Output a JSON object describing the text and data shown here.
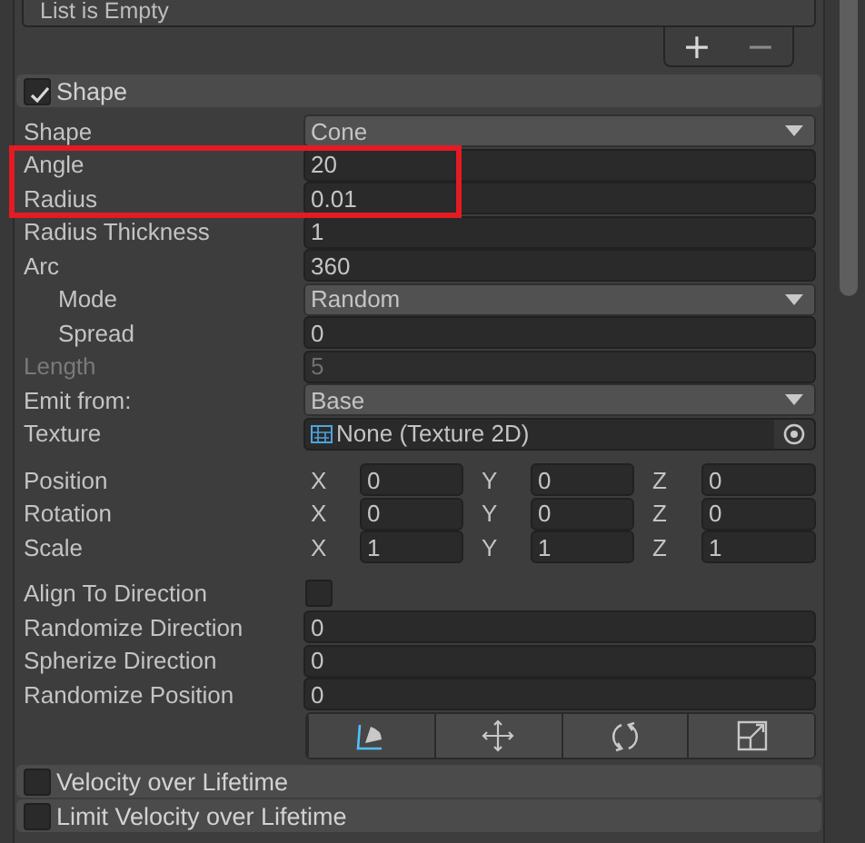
{
  "list": {
    "text": "List is Empty",
    "buttons": [
      "+",
      "−"
    ]
  },
  "module": {
    "title": "Shape",
    "checked": true
  },
  "groups": [
    [
      {
        "kind": "dropdown",
        "label": "Shape",
        "value": "Cone",
        "disabled": false,
        "highlighted": false
      },
      {
        "kind": "number",
        "label": "Angle",
        "value": "20",
        "disabled": false,
        "highlighted": true
      },
      {
        "kind": "number",
        "label": "Radius",
        "value": "0.01",
        "disabled": false,
        "highlighted": true
      },
      {
        "kind": "number",
        "label": "Radius Thickness",
        "value": "1",
        "disabled": false,
        "highlighted": false
      },
      {
        "kind": "number",
        "label": "Arc",
        "value": "360",
        "disabled": false,
        "highlighted": false,
        "children": [
          {
            "kind": "dropdown",
            "label": "Mode",
            "value": "Random",
            "disabled": false,
            "highlighted": false
          },
          {
            "kind": "number",
            "label": "Spread",
            "value": "0",
            "disabled": false,
            "highlighted": false
          }
        ]
      },
      {
        "kind": "number",
        "label": "Length",
        "value": "5",
        "disabled": true,
        "highlighted": false
      },
      {
        "kind": "dropdown",
        "label": "Emit from:",
        "value": "Base",
        "disabled": false,
        "highlighted": false
      },
      {
        "kind": "object",
        "label": "Texture",
        "value": "None (Texture 2D)",
        "disabled": false,
        "highlighted": false
      }
    ],
    [
      {
        "kind": "vector",
        "label": "Position",
        "disabled": false,
        "highlighted": false,
        "axes": [
          {
            "axis": "X",
            "value": "0"
          },
          {
            "axis": "Y",
            "value": "0"
          },
          {
            "axis": "Z",
            "value": "0"
          }
        ]
      },
      {
        "kind": "vector",
        "label": "Rotation",
        "disabled": false,
        "highlighted": false,
        "axes": [
          {
            "axis": "X",
            "value": "0"
          },
          {
            "axis": "Y",
            "value": "0"
          },
          {
            "axis": "Z",
            "value": "0"
          }
        ]
      },
      {
        "kind": "vector",
        "label": "Scale",
        "disabled": false,
        "highlighted": false,
        "axes": [
          {
            "axis": "X",
            "value": "1"
          },
          {
            "axis": "Y",
            "value": "1"
          },
          {
            "axis": "Z",
            "value": "1"
          }
        ]
      }
    ],
    [
      {
        "kind": "checkbox",
        "label": "Align To Direction",
        "checked": false,
        "disabled": false,
        "highlighted": false
      },
      {
        "kind": "number",
        "label": "Randomize Direction",
        "value": "0",
        "disabled": false,
        "highlighted": false
      },
      {
        "kind": "number",
        "label": "Spherize Direction",
        "value": "0",
        "disabled": false,
        "highlighted": false
      },
      {
        "kind": "number",
        "label": "Randomize Position",
        "value": "0",
        "disabled": false,
        "highlighted": false
      }
    ]
  ],
  "tools": [
    {
      "selected": true
    },
    {
      "selected": false
    },
    {
      "selected": false
    },
    {
      "selected": false
    }
  ],
  "modules": [
    {
      "title": "Velocity over Lifetime",
      "checked": false
    },
    {
      "title": "Limit Velocity over Lifetime",
      "checked": false
    }
  ]
}
